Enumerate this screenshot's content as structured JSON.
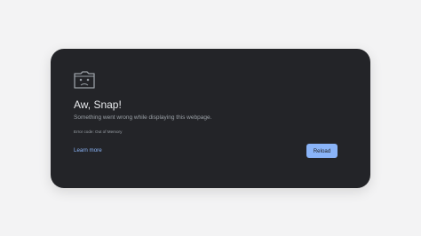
{
  "error_page": {
    "icon": "sad-tab-icon",
    "title": "Aw, Snap!",
    "message": "Something went wrong while displaying this webpage.",
    "error_code": "Error code: Out of Memory",
    "learn_more_label": "Learn more",
    "reload_label": "Reload"
  },
  "colors": {
    "background": "#f3f3f4",
    "card": "#232428",
    "title_text": "#e8eaed",
    "secondary_text": "#9aa0a6",
    "accent": "#8ab4f8"
  }
}
